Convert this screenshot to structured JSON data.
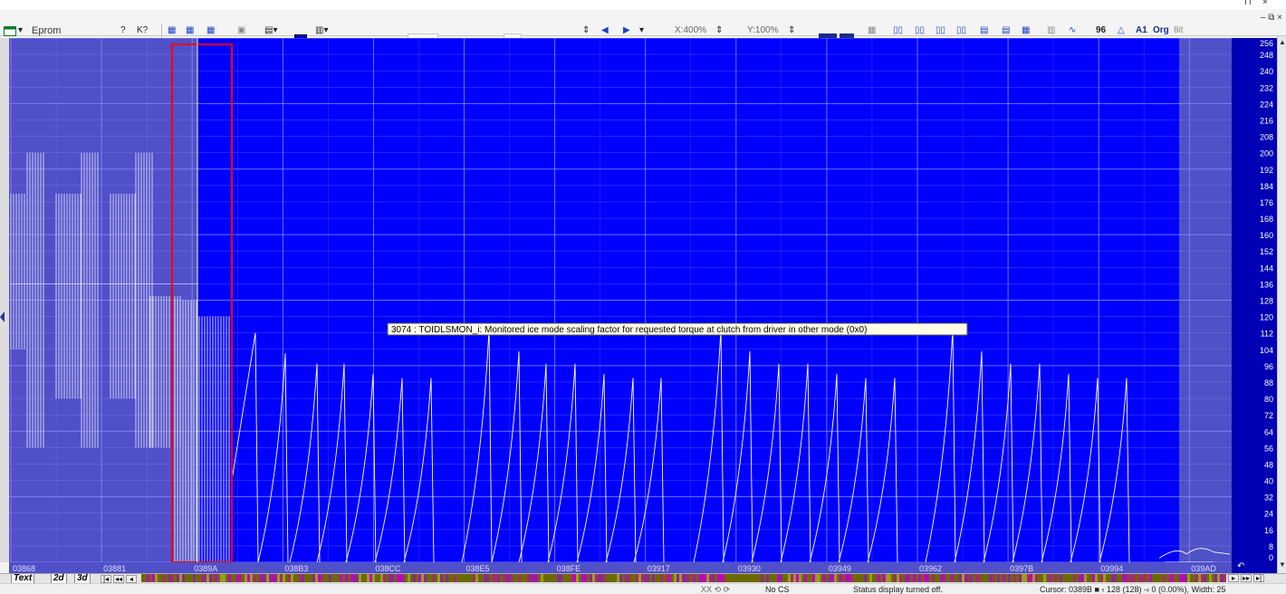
{
  "window": {
    "minimize_glyph": "⊓",
    "close_glyph": "×",
    "mdi_restore_glyph": "– ⧉ ×"
  },
  "toolbar": {
    "mode_label": "Eprom",
    "x_zoom": "X:400%",
    "y_zoom": "Y:100%",
    "btn_labels": [
      "?",
      "K?",
      "96",
      "A1",
      "Org",
      "8it"
    ],
    "icons": [
      "app-icon",
      "dropdown-icon",
      "help-icon",
      "context-help-icon",
      "map-icon",
      "map-edit-icon",
      "map-compare-icon",
      "copy-icon",
      "insert-icon",
      "color-icon",
      "columns-icon",
      "left-arrow-icon",
      "right-arrow-icon",
      "dropdown-icon"
    ]
  },
  "graph": {
    "background_color": "#0000ff",
    "highlight_color": "#5050c8",
    "cursor_box_color": "#ff0000",
    "tooltip": "3074 : TOIDLSMON_i: Monitored ice mode scaling factor for requested torque at clutch from driver in other mode (0x0)"
  },
  "axes": {
    "y_ticks": [
      "256",
      "248",
      "240",
      "232",
      "224",
      "216",
      "208",
      "200",
      "192",
      "184",
      "176",
      "168",
      "160",
      "152",
      "144",
      "136",
      "128",
      "120",
      "112",
      "104",
      "96",
      "88",
      "80",
      "72",
      "64",
      "56",
      "48",
      "40",
      "32",
      "24",
      "16",
      "8",
      "0"
    ],
    "x_ticks": [
      "03868",
      "03881",
      "0389A",
      "038B3",
      "038CC",
      "038E5",
      "038FE",
      "03917",
      "03930",
      "03949",
      "03962",
      "0397B",
      "03994",
      "039AD"
    ]
  },
  "tabs": {
    "text": "Text",
    "two_d": "2d",
    "three_d": "3d",
    "nav": [
      "|◂",
      "◂◂",
      "◂"
    ],
    "nav_right": [
      "▸",
      "▸▸",
      "▸|"
    ]
  },
  "status": {
    "indicators": "XX ⟲ ⟳",
    "checksum": "No CS",
    "message": "Status display turned off.",
    "cursor": "Cursor: 0389B ■ ‹ 128 (128) -› 0 (0.00%), Width: 25"
  }
}
